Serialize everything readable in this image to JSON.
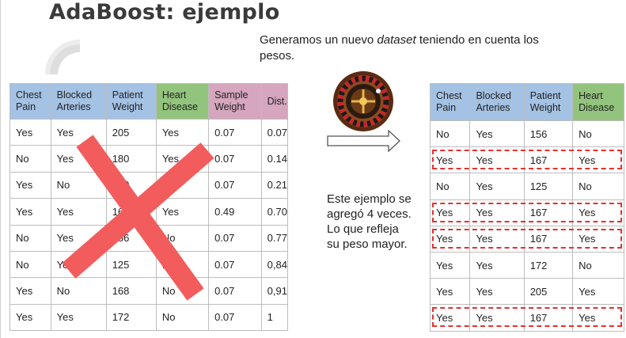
{
  "title": "AdaBoost: ejemplo",
  "subtitle": {
    "before": "Generamos un nuevo ",
    "emph": "dataset",
    "after": " teniendo en cuenta los pesos."
  },
  "left_table": {
    "headers": [
      "Chest Pain",
      "Blocked Arteries",
      "Patient Weight",
      "Heart Disease",
      "Sample Weight",
      "Dist."
    ],
    "rows": [
      [
        "Yes",
        "Yes",
        "205",
        "Yes",
        "0.07",
        "0.07"
      ],
      [
        "No",
        "Yes",
        "180",
        "Yes",
        "0.07",
        "0.14"
      ],
      [
        "Yes",
        "No",
        "210",
        "Yes",
        "0.07",
        "0.21"
      ],
      [
        "Yes",
        "Yes",
        "167",
        "Yes",
        "0.49",
        "0.70"
      ],
      [
        "No",
        "Yes",
        "156",
        "No",
        "0.07",
        "0.77"
      ],
      [
        "No",
        "Yes",
        "125",
        "No",
        "0.07",
        "0,84"
      ],
      [
        "Yes",
        "No",
        "168",
        "No",
        "0.07",
        "0,91"
      ],
      [
        "Yes",
        "Yes",
        "172",
        "No",
        "0.07",
        "1"
      ]
    ]
  },
  "right_table": {
    "headers": [
      "Chest Pain",
      "Blocked Arteries",
      "Patient Weight",
      "Heart Disease"
    ],
    "rows": [
      [
        "No",
        "Yes",
        "156",
        "No"
      ],
      [
        "Yes",
        "Yes",
        "167",
        "Yes"
      ],
      [
        "No",
        "Yes",
        "125",
        "No"
      ],
      [
        "Yes",
        "Yes",
        "167",
        "Yes"
      ],
      [
        "Yes",
        "Yes",
        "167",
        "Yes"
      ],
      [
        "Yes",
        "Yes",
        "172",
        "No"
      ],
      [
        "Yes",
        "Yes",
        "205",
        "Yes"
      ],
      [
        "Yes",
        "Yes",
        "167",
        "Yes"
      ]
    ],
    "highlighted_rows": [
      1,
      3,
      4,
      7
    ]
  },
  "note": "Este ejemplo se agregó 4 veces. Lo que refleja su peso mayor.",
  "colors": {
    "header_blue": "#a4c2e4",
    "header_green": "#93c47d",
    "header_pink": "#d5a6bd",
    "cross_red": "#f25c5c",
    "dash_red": "#e53030"
  },
  "icons": [
    "roulette-icon",
    "right-arrow-icon",
    "cross-mark-icon"
  ]
}
